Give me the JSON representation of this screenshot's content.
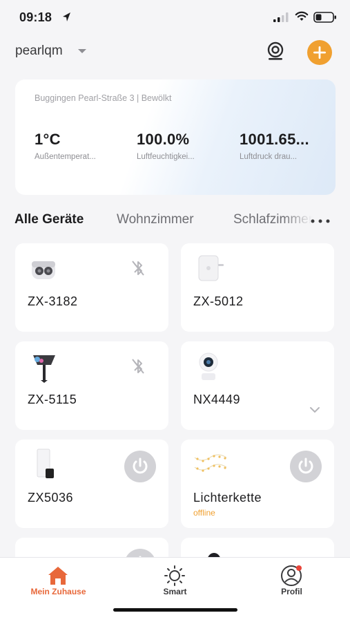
{
  "status_bar": {
    "time": "09:18"
  },
  "header": {
    "home_name": "pearlqm"
  },
  "weather": {
    "location": "Buggingen Pearl-Straße 3 | Bewölkt",
    "stats": [
      {
        "value": "1°C",
        "label": "Außentemperat..."
      },
      {
        "value": "100.0%",
        "label": "Luftfeuchtigkei..."
      },
      {
        "value": "1001.65...",
        "label": "Luftdruck drau..."
      }
    ]
  },
  "tabs": {
    "items": [
      "Alle Geräte",
      "Wohnzimmer",
      "Schlafzimmer"
    ],
    "active_index": 0
  },
  "devices": [
    {
      "name": "ZX-3182",
      "control": "bluetooth-off",
      "image": "earbuds"
    },
    {
      "name": "ZX-5012",
      "control": "none",
      "image": "plug"
    },
    {
      "name": "ZX-5115",
      "control": "bluetooth-off",
      "image": "spotlight"
    },
    {
      "name": "NX4449",
      "control": "chevron",
      "image": "camera"
    },
    {
      "name": "ZX5036",
      "control": "power",
      "image": "wall-light"
    },
    {
      "name": "Lichterkette",
      "status": "offline",
      "control": "power",
      "image": "string-lights"
    },
    {
      "name": "",
      "control": "power",
      "image": "string-lights"
    },
    {
      "name": "",
      "control": "none",
      "image": "camera"
    }
  ],
  "tabbar": {
    "items": [
      {
        "label": "Mein Zuhause",
        "icon": "home-icon",
        "active": true
      },
      {
        "label": "Smart",
        "icon": "sun-icon",
        "active": false
      },
      {
        "label": "Profil",
        "icon": "profile-icon",
        "active": false
      }
    ]
  },
  "colors": {
    "accent_orange": "#f0a030",
    "active_tab_red": "#e8683a",
    "background": "#f5f5f7",
    "card": "#ffffff",
    "offline_text": "#f0a030"
  }
}
